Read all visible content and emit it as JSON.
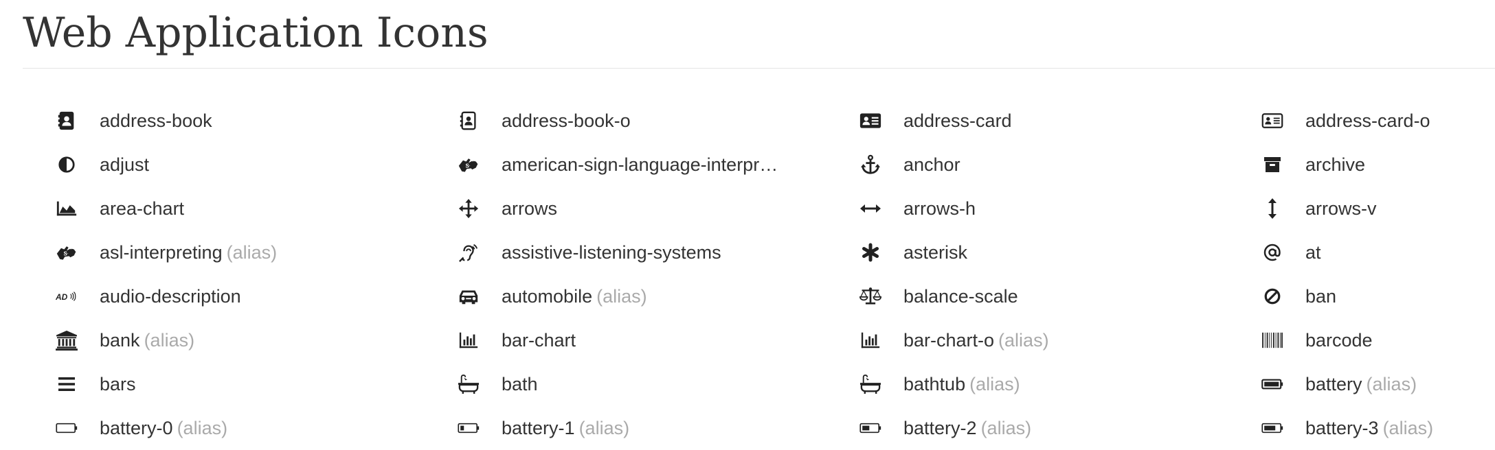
{
  "page": {
    "title": "Web Application Icons"
  },
  "icons": [
    {
      "name": "address-book",
      "alias": "",
      "icon": "address-book-icon"
    },
    {
      "name": "address-book-o",
      "alias": "",
      "icon": "address-book-o-icon"
    },
    {
      "name": "address-card",
      "alias": "",
      "icon": "address-card-icon"
    },
    {
      "name": "address-card-o",
      "alias": "",
      "icon": "address-card-o-icon"
    },
    {
      "name": "adjust",
      "alias": "",
      "icon": "adjust-icon"
    },
    {
      "name": "american-sign-language-interpr…",
      "alias": "",
      "icon": "american-sign-language-interpreting-icon"
    },
    {
      "name": "anchor",
      "alias": "",
      "icon": "anchor-icon"
    },
    {
      "name": "archive",
      "alias": "",
      "icon": "archive-icon"
    },
    {
      "name": "area-chart",
      "alias": "",
      "icon": "area-chart-icon"
    },
    {
      "name": "arrows",
      "alias": "",
      "icon": "arrows-icon"
    },
    {
      "name": "arrows-h",
      "alias": "",
      "icon": "arrows-h-icon"
    },
    {
      "name": "arrows-v",
      "alias": "",
      "icon": "arrows-v-icon"
    },
    {
      "name": "asl-interpreting",
      "alias": "(alias)",
      "icon": "asl-interpreting-icon"
    },
    {
      "name": "assistive-listening-systems",
      "alias": "",
      "icon": "assistive-listening-systems-icon"
    },
    {
      "name": "asterisk",
      "alias": "",
      "icon": "asterisk-icon"
    },
    {
      "name": "at",
      "alias": "",
      "icon": "at-icon"
    },
    {
      "name": "audio-description",
      "alias": "",
      "icon": "audio-description-icon"
    },
    {
      "name": "automobile",
      "alias": "(alias)",
      "icon": "automobile-icon"
    },
    {
      "name": "balance-scale",
      "alias": "",
      "icon": "balance-scale-icon"
    },
    {
      "name": "ban",
      "alias": "",
      "icon": "ban-icon"
    },
    {
      "name": "bank",
      "alias": "(alias)",
      "icon": "bank-icon"
    },
    {
      "name": "bar-chart",
      "alias": "",
      "icon": "bar-chart-icon"
    },
    {
      "name": "bar-chart-o",
      "alias": "(alias)",
      "icon": "bar-chart-o-icon"
    },
    {
      "name": "barcode",
      "alias": "",
      "icon": "barcode-icon"
    },
    {
      "name": "bars",
      "alias": "",
      "icon": "bars-icon"
    },
    {
      "name": "bath",
      "alias": "",
      "icon": "bath-icon"
    },
    {
      "name": "bathtub",
      "alias": "(alias)",
      "icon": "bathtub-icon"
    },
    {
      "name": "battery",
      "alias": "(alias)",
      "icon": "battery-icon"
    },
    {
      "name": "battery-0",
      "alias": "(alias)",
      "icon": "battery-0-icon"
    },
    {
      "name": "battery-1",
      "alias": "(alias)",
      "icon": "battery-1-icon"
    },
    {
      "name": "battery-2",
      "alias": "(alias)",
      "icon": "battery-2-icon"
    },
    {
      "name": "battery-3",
      "alias": "(alias)",
      "icon": "battery-3-icon"
    }
  ]
}
